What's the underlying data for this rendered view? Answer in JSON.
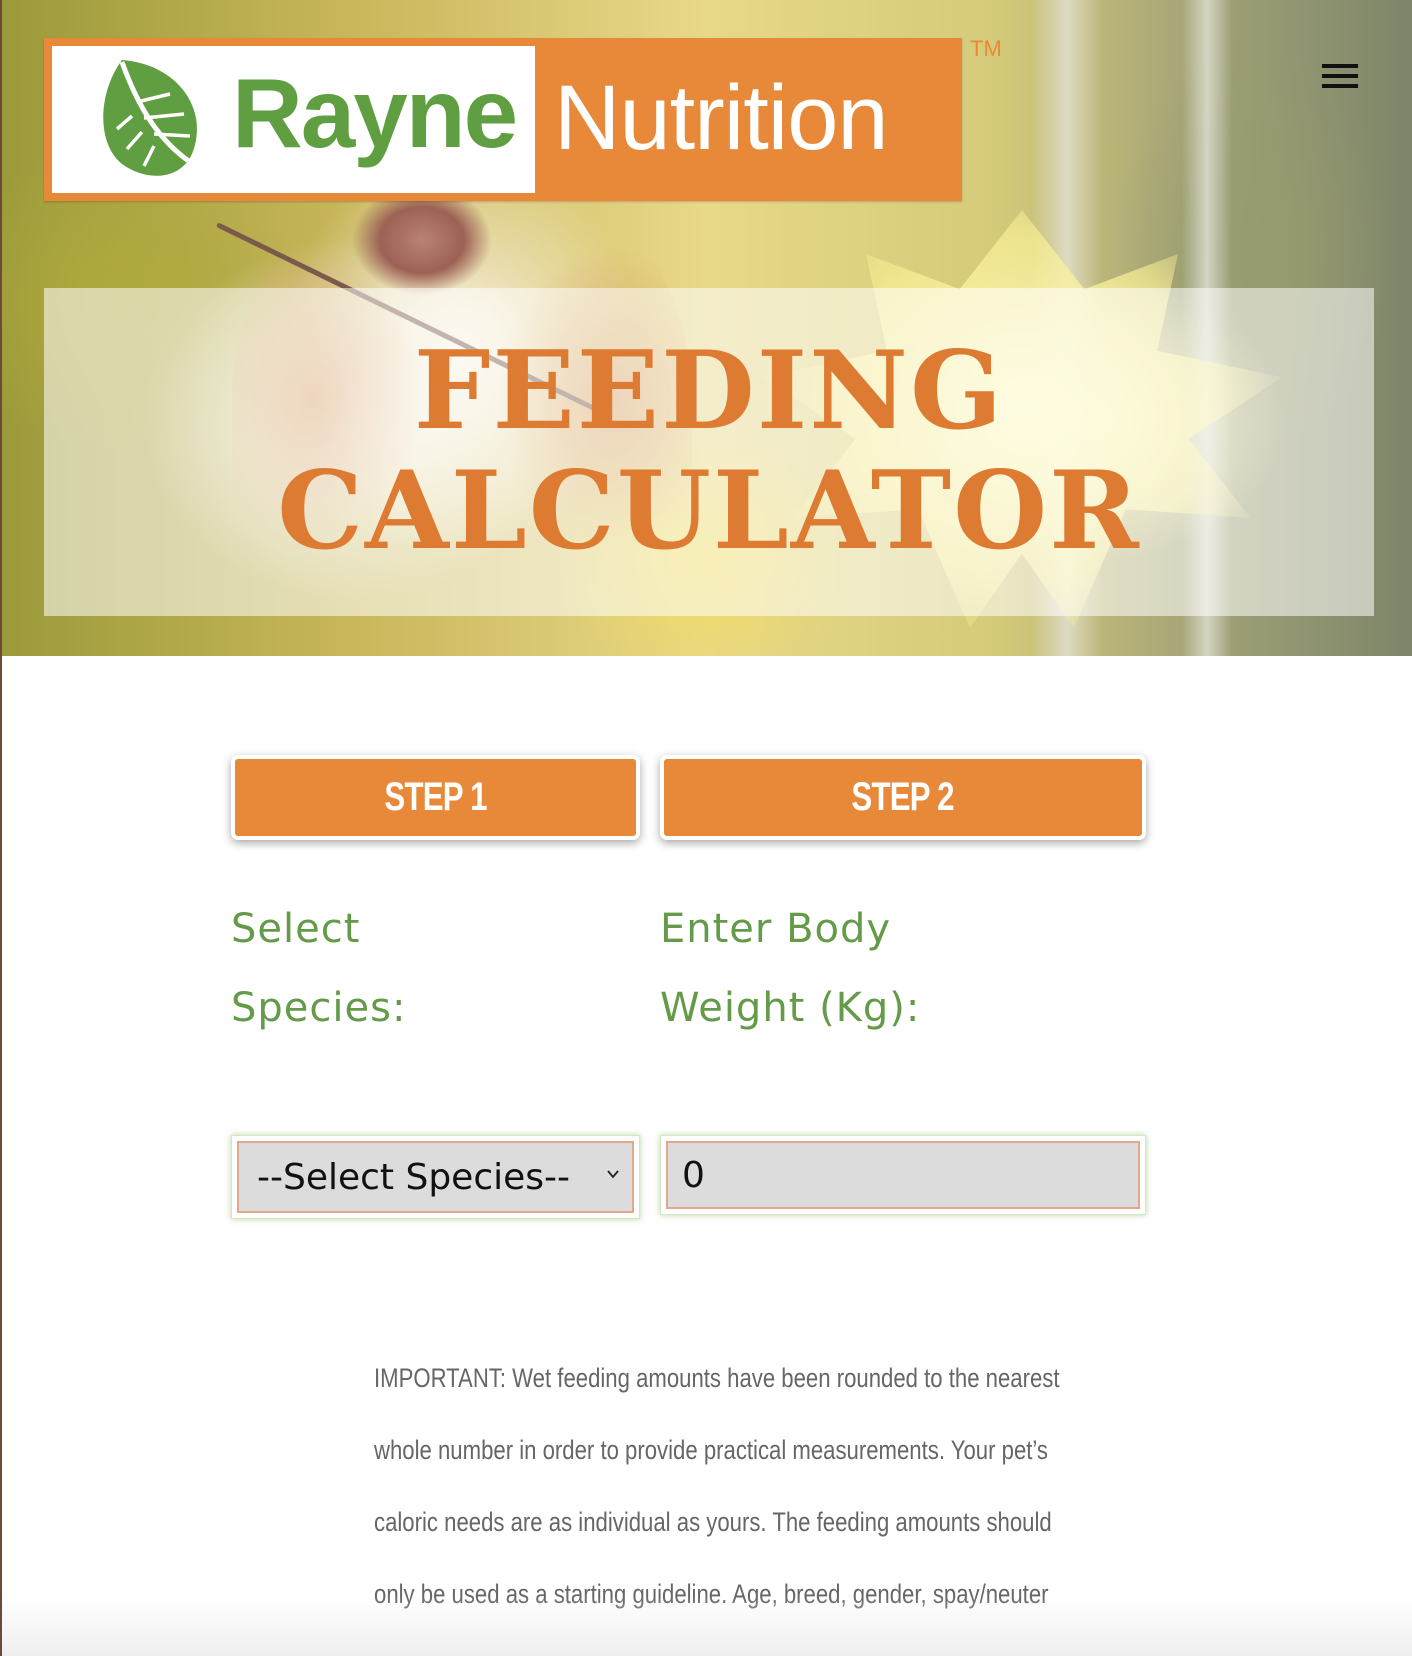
{
  "header": {
    "logo_word1": "Rayne",
    "logo_word2": "Nutrition",
    "trademark": "TM",
    "menu_icon": "hamburger-menu-icon"
  },
  "hero": {
    "title_line1": "FEEDING",
    "title_line2": "CALCULATOR"
  },
  "steps": [
    {
      "label": "STEP 1",
      "prompt_line1": "Select",
      "prompt_line2": "Species:"
    },
    {
      "label": "STEP 2",
      "prompt_line1": "Enter Body",
      "prompt_line2": "Weight (Kg):"
    }
  ],
  "species_select": {
    "selected": "--Select Species--"
  },
  "weight_input": {
    "value": "0"
  },
  "notice": {
    "lines": [
      "IMPORTANT: Wet feeding amounts have been rounded to the nearest",
      "whole number in order to provide practical measurements. Your pet’s",
      "caloric needs are as individual as yours. The feeding amounts should",
      "only be used as a starting guideline. Age, breed, gender, spay/neuter"
    ]
  },
  "colors": {
    "brand_orange": "#e8893a",
    "brand_green": "#5f9e41",
    "title_orange": "#dd7b32",
    "label_green": "#649b49"
  }
}
